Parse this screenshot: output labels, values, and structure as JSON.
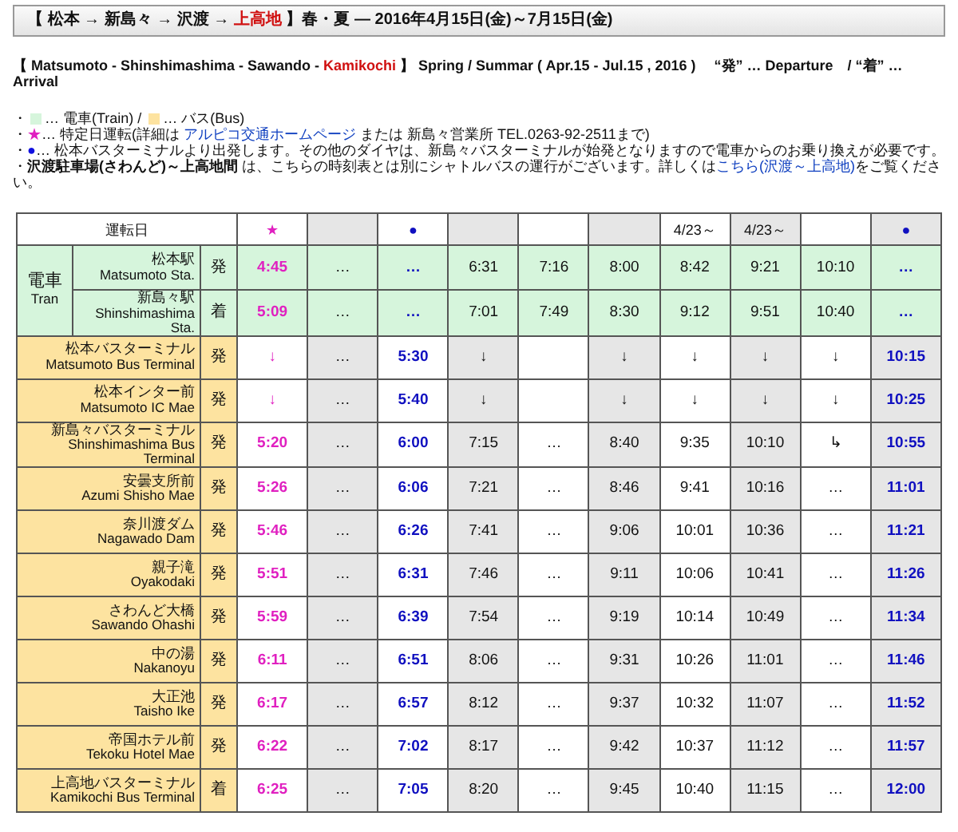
{
  "title": [
    {
      "text": "【 松本 → 新島々 → 沢渡 → ",
      "highlight": false
    },
    {
      "text": "上高地",
      "highlight": true
    },
    {
      "text": " 】春・夏 ― 2016年4月15日(金)～7月15日(金)",
      "highlight": false
    }
  ],
  "subtitle": [
    {
      "text": "【 Matsumoto - Shinshimashima - Sawando - ",
      "highlight": false
    },
    {
      "text": "Kamikochi",
      "highlight": true
    },
    {
      "text": " 】 Spring / Summar ( Apr.15 - Jul.15 , 2016 )　 “発” … Departure　/ “着” … Arrival",
      "highlight": false
    }
  ],
  "notes": [
    [
      {
        "kind": "text",
        "text": "・"
      },
      {
        "kind": "swatch",
        "color": "#d6f5dc"
      },
      {
        "kind": "text",
        "text": "… 電車(Train) / "
      },
      {
        "kind": "swatch",
        "color": "#fde3a0"
      },
      {
        "kind": "text",
        "text": "… バス(Bus)"
      }
    ],
    [
      {
        "kind": "text",
        "text": "・"
      },
      {
        "kind": "symbol",
        "text": "★",
        "color": "#e020c0"
      },
      {
        "kind": "text",
        "text": "… 特定日運転(詳細は "
      },
      {
        "kind": "link",
        "text": "アルピコ交通ホームページ"
      },
      {
        "kind": "text",
        "text": " または 新島々営業所 TEL.0263-92-2511まで)"
      }
    ],
    [
      {
        "kind": "text",
        "text": "・"
      },
      {
        "kind": "symbol",
        "text": "●",
        "color": "#1010e0"
      },
      {
        "kind": "text",
        "text": "… 松本バスターミナルより出発します。その他のダイヤは、新島々バスターミナルが始発となりますので電車からのお乗り換えが必要です。"
      }
    ],
    [
      {
        "kind": "text",
        "text": "・"
      },
      {
        "kind": "bold",
        "text": "沢渡駐車場(さわんど)～上高地間"
      },
      {
        "kind": "text",
        "text": " は、こちらの時刻表とは別にシャトルバスの運行がございます。詳しくは"
      },
      {
        "kind": "link",
        "text": "こちら(沢渡～上高地)"
      },
      {
        "kind": "text",
        "text": "をご覧ください。"
      }
    ]
  ],
  "table": {
    "corner": "運転日",
    "train_group": {
      "ja": "電車",
      "en": "Tran"
    },
    "columns": [
      {
        "header": "★",
        "color": "#e020c0",
        "shaded": false
      },
      {
        "shaded": true
      },
      {
        "header": "●",
        "color": "#1010c0",
        "shaded": false
      },
      {
        "shaded": true
      },
      {
        "shaded": false
      },
      {
        "shaded": true
      },
      {
        "header": "4/23～",
        "shaded": false
      },
      {
        "header": "4/23～",
        "shaded": true
      },
      {
        "shaded": false
      },
      {
        "header": "●",
        "color": "#1010c0",
        "shaded": true
      }
    ],
    "rows": [
      {
        "kind": "train",
        "ja": "松本駅",
        "en": "Matsumoto Sta.",
        "stop": "発",
        "times": [
          "4:45",
          "…",
          "…",
          "6:31",
          "7:16",
          "8:00",
          "8:42",
          "9:21",
          "10:10",
          "…"
        ]
      },
      {
        "kind": "train",
        "ja": "新島々駅",
        "en": "Shinshimashima Sta.",
        "stop": "着",
        "times": [
          "5:09",
          "…",
          "…",
          "7:01",
          "7:49",
          "8:30",
          "9:12",
          "9:51",
          "10:40",
          "…"
        ]
      },
      {
        "kind": "bus",
        "ja": "松本バスターミナル",
        "en": "Matsumoto Bus Terminal",
        "stop": "発",
        "times": [
          "↓",
          "…",
          "5:30",
          "↓",
          {
            "kind": "blank"
          },
          "↓",
          "↓",
          "↓",
          "↓",
          "10:15"
        ]
      },
      {
        "kind": "bus",
        "ja": "松本インター前",
        "en": "Matsumoto IC Mae",
        "stop": "発",
        "times": [
          "↓",
          "…",
          "5:40",
          "↓",
          {
            "kind": "blank"
          },
          "↓",
          "↓",
          "↓",
          "↓",
          "10:25"
        ]
      },
      {
        "kind": "bus",
        "ja": "新島々バスターミナル",
        "en": "Shinshimashima Bus Terminal",
        "stop": "発",
        "times": [
          "5:20",
          "…",
          "6:00",
          "7:15",
          "…",
          "8:40",
          "9:35",
          "10:10",
          "↳",
          "10:55"
        ]
      },
      {
        "kind": "bus",
        "ja": "安曇支所前",
        "en": "Azumi Shisho Mae",
        "stop": "発",
        "times": [
          "5:26",
          "…",
          "6:06",
          "7:21",
          "…",
          "8:46",
          "9:41",
          "10:16",
          "…",
          "11:01"
        ]
      },
      {
        "kind": "bus",
        "ja": "奈川渡ダム",
        "en": "Nagawado Dam",
        "stop": "発",
        "times": [
          "5:46",
          "…",
          "6:26",
          "7:41",
          "…",
          "9:06",
          "10:01",
          "10:36",
          "…",
          "11:21"
        ]
      },
      {
        "kind": "bus",
        "ja": "親子滝",
        "en": "Oyakodaki",
        "stop": "発",
        "times": [
          "5:51",
          "…",
          "6:31",
          "7:46",
          "…",
          "9:11",
          "10:06",
          "10:41",
          "…",
          "11:26"
        ]
      },
      {
        "kind": "bus",
        "ja": "さわんど大橋",
        "en": "Sawando Ohashi",
        "stop": "発",
        "times": [
          "5:59",
          "…",
          "6:39",
          "7:54",
          "…",
          "9:19",
          "10:14",
          "10:49",
          "…",
          "11:34"
        ]
      },
      {
        "kind": "bus",
        "ja": "中の湯",
        "en": "Nakanoyu",
        "stop": "発",
        "times": [
          "6:11",
          "…",
          "6:51",
          "8:06",
          "…",
          "9:31",
          "10:26",
          "11:01",
          "…",
          "11:46"
        ]
      },
      {
        "kind": "bus",
        "ja": "大正池",
        "en": "Taisho Ike",
        "stop": "発",
        "times": [
          "6:17",
          "…",
          "6:57",
          "8:12",
          "…",
          "9:37",
          "10:32",
          "11:07",
          "…",
          "11:52"
        ]
      },
      {
        "kind": "bus",
        "ja": "帝国ホテル前",
        "en": "Tekoku Hotel Mae",
        "stop": "発",
        "times": [
          "6:22",
          "…",
          "7:02",
          "8:17",
          "…",
          "9:42",
          "10:37",
          "11:12",
          "…",
          "11:57"
        ]
      },
      {
        "kind": "bus",
        "ja": "上高地バスターミナル",
        "en": "Kamikochi Bus Terminal",
        "stop": "着",
        "times": [
          "6:25",
          "…",
          "7:05",
          "8:20",
          "…",
          "9:45",
          "10:40",
          "11:15",
          "…",
          "12:00"
        ]
      }
    ]
  }
}
